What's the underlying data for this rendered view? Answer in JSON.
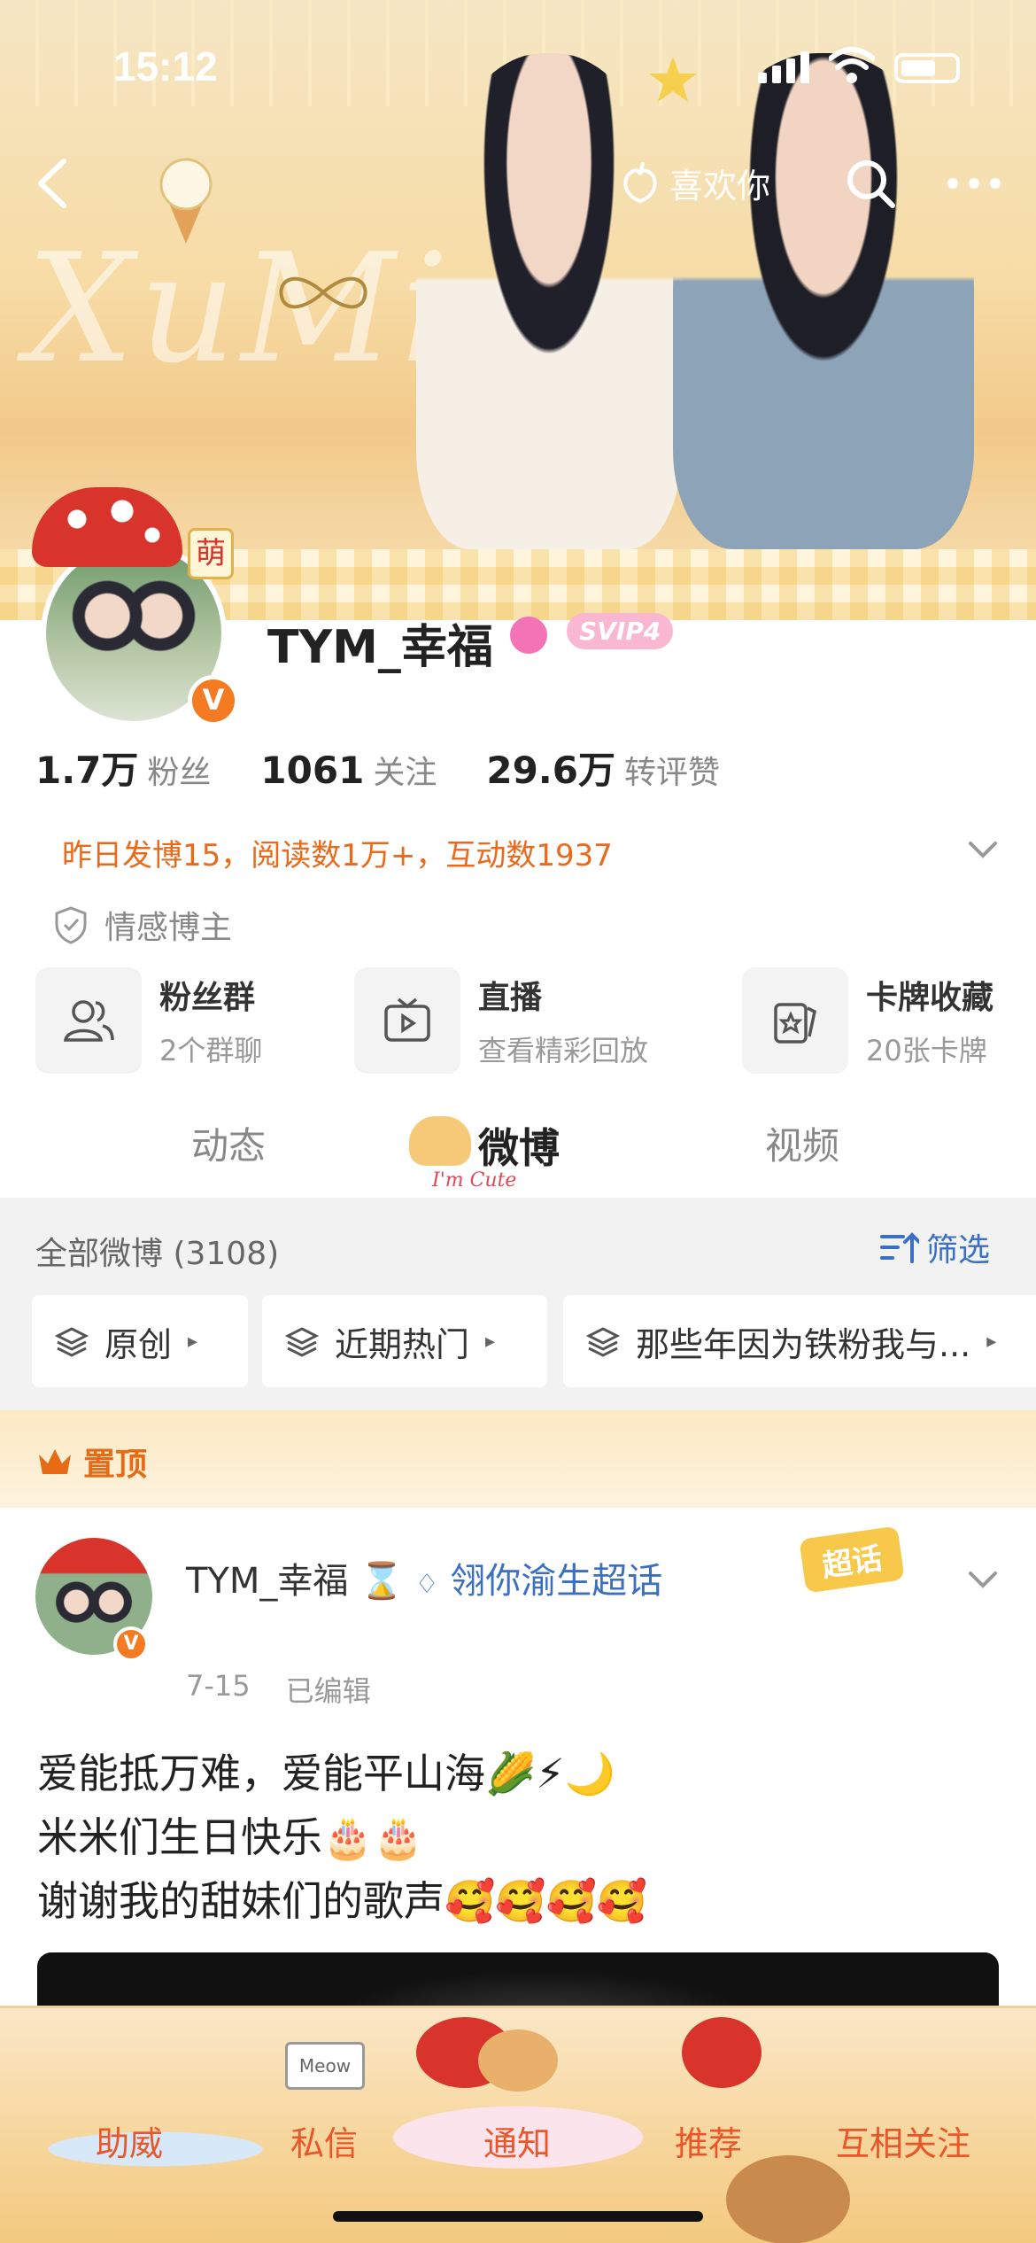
{
  "status_bar": {
    "time": "15:12"
  },
  "header": {
    "like_label": "喜欢你",
    "banner_script": "XuMing"
  },
  "profile": {
    "username": "TYM_幸福",
    "vip_badge": "SVIP4",
    "avatar_sticker": "萌",
    "stats": [
      {
        "num": "1.7万",
        "label": "粉丝"
      },
      {
        "num": "1061",
        "label": "关注"
      },
      {
        "num": "29.6万",
        "label": "转评赞"
      }
    ],
    "summary": "昨日发博15，阅读数1万+，互动数1937",
    "tag": "情感博主"
  },
  "quick_actions": [
    {
      "title": "粉丝群",
      "subtitle": "2个群聊",
      "icon": "group-icon"
    },
    {
      "title": "直播",
      "subtitle": "查看精彩回放",
      "icon": "tv-icon"
    },
    {
      "title": "卡牌收藏",
      "subtitle": "20张卡牌",
      "icon": "card-icon"
    }
  ],
  "tabs": [
    {
      "label": "动态"
    },
    {
      "label": "微博"
    },
    {
      "label": "视频"
    }
  ],
  "tab_decor": "I'm Cute",
  "feed": {
    "all_label": "全部微博 (3108)",
    "filter_label": "筛选",
    "chips": [
      "原创",
      "近期热门",
      "那些年因为铁粉我与..."
    ],
    "pinned_label": "置顶"
  },
  "post": {
    "user": "TYM_幸福",
    "user_separator": "⌛",
    "topic": "翎你渝生超话",
    "date": "7-15",
    "edited": "已编辑",
    "badge": "超话",
    "lines": [
      "爱能抵万难，爱能平山海🌽⚡🌙",
      "米米们生日快乐🎂🎂",
      "谢谢我的甜妹们的歌声🥰🥰🥰🥰"
    ]
  },
  "bottom_nav": [
    {
      "label": "助威"
    },
    {
      "label": "私信"
    },
    {
      "label": "通知"
    },
    {
      "label": "推荐"
    },
    {
      "label": "互相关注"
    }
  ],
  "bottom_sticker": "Meow",
  "colors": {
    "accent_orange": "#e76a15",
    "link_blue": "#3b6fc4",
    "verified_orange": "#f47b21"
  }
}
